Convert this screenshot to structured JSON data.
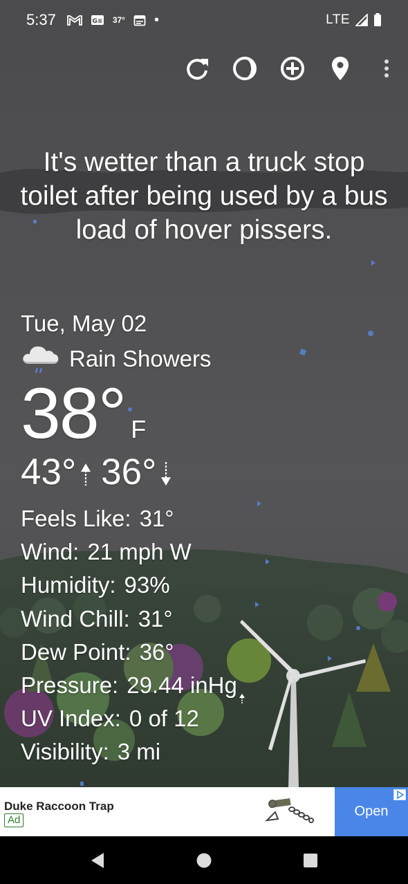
{
  "status_bar": {
    "time": "5:37",
    "temp": "37°",
    "network": "LTE",
    "icons": [
      "gmail-icon",
      "news-icon",
      "calendar-icon",
      "dot-icon",
      "signal-icon",
      "battery-icon"
    ]
  },
  "toolbar": {
    "icons": [
      "refresh-icon",
      "theme-icon",
      "add-location-icon",
      "location-pin-icon",
      "more-vert-icon"
    ]
  },
  "quote": "It's wetter than a truck stop toilet after being used by a bus load of hover pissers.",
  "weather": {
    "date": "Tue, May 02",
    "condition": "Rain Showers",
    "condition_icon": "rain-cloud-icon",
    "temperature": "38",
    "degree": "°",
    "unit": "F",
    "high": "43°",
    "low": "36°",
    "details": [
      {
        "label": "Feels Like:",
        "value": "31°"
      },
      {
        "label": "Wind:",
        "value": "21 mph W"
      },
      {
        "label": "Humidity:",
        "value": "93%"
      },
      {
        "label": "Wind Chill:",
        "value": "31°"
      },
      {
        "label": "Dew Point:",
        "value": "36°"
      },
      {
        "label": "Pressure:",
        "value": "29.44 inHg"
      },
      {
        "label": "UV Index:",
        "value": "0 of 12"
      },
      {
        "label": "Visibility:",
        "value": "3 mi"
      }
    ]
  },
  "ad": {
    "title": "Duke Raccoon Trap",
    "badge": "Ad",
    "button": "Open"
  },
  "colors": {
    "sky": "#4d4d4f",
    "cloud": "#3a3a3c",
    "ground": "#2e3a2e",
    "accent_blue": "#4a86e8"
  }
}
